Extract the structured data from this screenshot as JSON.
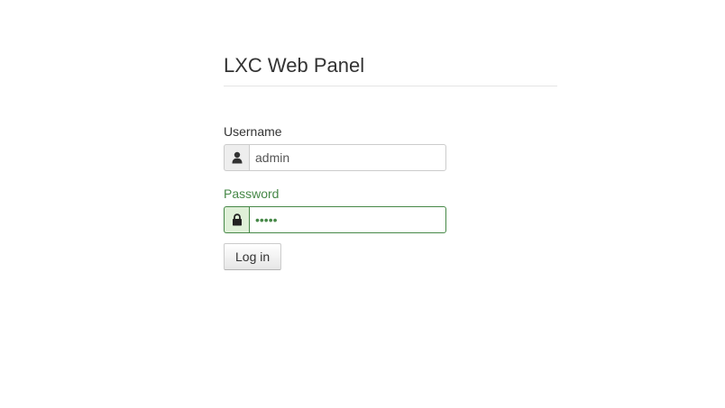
{
  "app": {
    "title": "LXC Web Panel"
  },
  "login_form": {
    "username": {
      "label": "Username",
      "value": "admin",
      "icon": "user-icon"
    },
    "password": {
      "label": "Password",
      "value": "•••••",
      "icon": "lock-icon",
      "state_color": "#468847"
    },
    "submit_label": "Log in"
  }
}
